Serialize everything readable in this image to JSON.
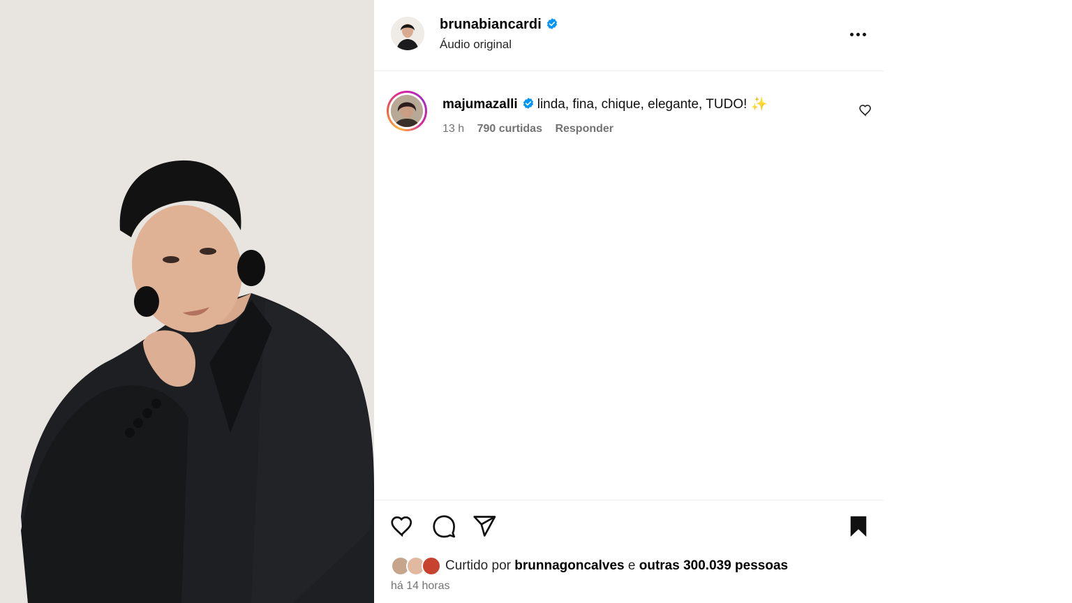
{
  "post": {
    "username": "brunabiancardi",
    "audio": "Áudio original",
    "more_icon": "more-horizontal-icon"
  },
  "comment": {
    "username": "majumazalli",
    "text": "linda, fina, chique, elegante, TUDO!",
    "emoji": "✨",
    "time": "13 h",
    "likes": "790 curtidas",
    "reply": "Responder"
  },
  "likes": {
    "prefix": "Curtido por",
    "user": "brunnagoncalves",
    "joiner": "e",
    "others": "outras 300.039 pessoas"
  },
  "timestamp": "há 14 horas",
  "colors": {
    "verified": "#0095f6",
    "secondary_text": "#737373",
    "divider": "#efefef"
  }
}
